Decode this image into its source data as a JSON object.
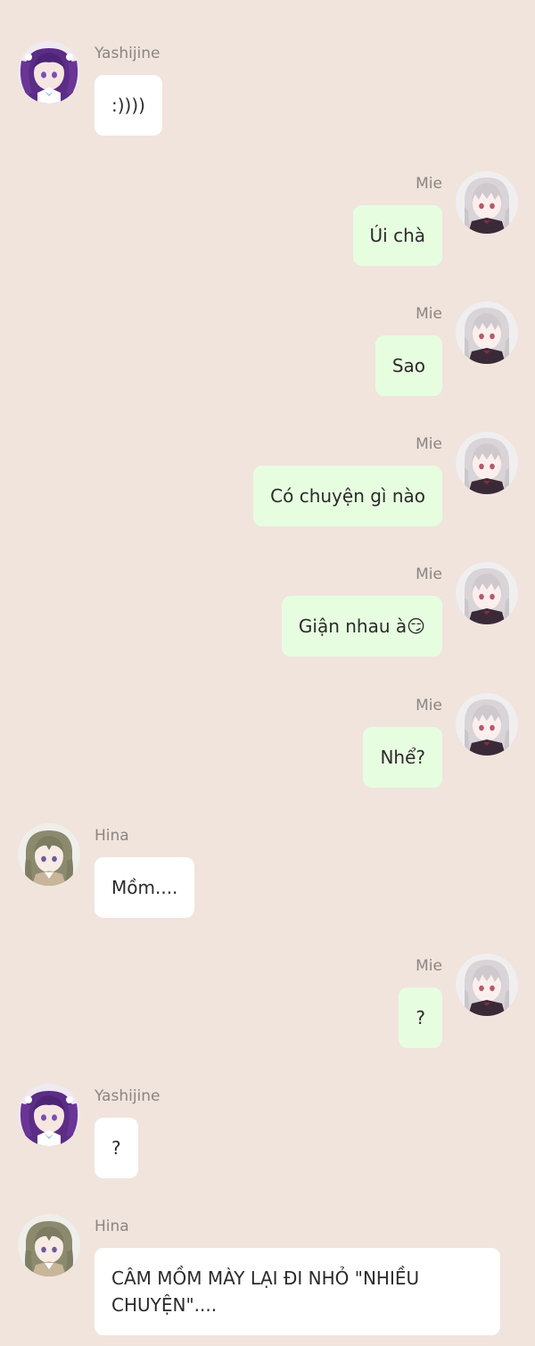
{
  "colors": {
    "background": "#f0e4dd",
    "bubble_other": "#ffffff",
    "bubble_self": "#e7fde0",
    "name_text": "#8b8682",
    "message_text": "#2b2b2b"
  },
  "messages": [
    {
      "sender": "Yashijine",
      "side": "left",
      "avatar": "avatar-yashijine",
      "text": ":))))"
    },
    {
      "sender": "Mie",
      "side": "right",
      "avatar": "avatar-mie",
      "text": "Úi chà"
    },
    {
      "sender": "Mie",
      "side": "right",
      "avatar": "avatar-mie",
      "text": "Sao"
    },
    {
      "sender": "Mie",
      "side": "right",
      "avatar": "avatar-mie",
      "text": "Có chuyện gì nào"
    },
    {
      "sender": "Mie",
      "side": "right",
      "avatar": "avatar-mie",
      "text": "Giận nhau à😏"
    },
    {
      "sender": "Mie",
      "side": "right",
      "avatar": "avatar-mie",
      "text": "Nhể?"
    },
    {
      "sender": "Hina",
      "side": "left",
      "avatar": "avatar-hina",
      "text": "Mồm...."
    },
    {
      "sender": "Mie",
      "side": "right",
      "avatar": "avatar-mie",
      "text": "?"
    },
    {
      "sender": "Yashijine",
      "side": "left",
      "avatar": "avatar-yashijine",
      "text": "?"
    },
    {
      "sender": "Hina",
      "side": "left",
      "avatar": "avatar-hina",
      "text": "CÂM MỒM MÀY LẠI ĐI NHỎ \"NHIỀU CHUYỆN\"...."
    }
  ]
}
